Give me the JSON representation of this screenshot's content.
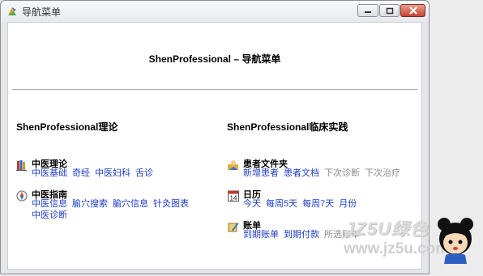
{
  "window": {
    "title": "导航菜单",
    "controls": [
      "minimize",
      "maximize",
      "close"
    ]
  },
  "page": {
    "title": "ShenProfessional – 导航菜单"
  },
  "sections": [
    {
      "heading": "ShenProfessional理论",
      "groups": [
        {
          "icon": "books-icon",
          "title": "中医理论",
          "links": [
            {
              "label": "中医基础",
              "enabled": true
            },
            {
              "label": "奇经",
              "enabled": true
            },
            {
              "label": "中医妇科",
              "enabled": true
            },
            {
              "label": "舌诊",
              "enabled": true
            }
          ]
        },
        {
          "icon": "compass-icon",
          "title": "中医指南",
          "links": [
            {
              "label": "中医信息",
              "enabled": true
            },
            {
              "label": "腧穴搜索",
              "enabled": true
            },
            {
              "label": "腧穴信息",
              "enabled": true
            },
            {
              "label": "针灸图表",
              "enabled": true
            },
            {
              "label": "中医诊断",
              "enabled": true
            }
          ]
        }
      ]
    },
    {
      "heading": "ShenProfessional临床实践",
      "groups": [
        {
          "icon": "patient-folder-icon",
          "title": "患者文件夹",
          "links": [
            {
              "label": "新增患者",
              "enabled": true
            },
            {
              "label": "患者文档",
              "enabled": true
            },
            {
              "label": "下次诊断",
              "enabled": false
            },
            {
              "label": "下次治疗",
              "enabled": false
            }
          ]
        },
        {
          "icon": "calendar-icon",
          "calendar_day": "14",
          "title": "日历",
          "links": [
            {
              "label": "今天",
              "enabled": true
            },
            {
              "label": "每周5天",
              "enabled": true
            },
            {
              "label": "每周7天",
              "enabled": true
            },
            {
              "label": "月份",
              "enabled": true
            }
          ]
        },
        {
          "icon": "bill-pen-icon",
          "title": "账单",
          "links": [
            {
              "label": "到期账单",
              "enabled": true
            },
            {
              "label": "到期付款",
              "enabled": true
            },
            {
              "label": "所选账单",
              "enabled": false
            }
          ]
        }
      ]
    }
  ],
  "watermark": {
    "text": "JZ5U绿色",
    "url": "www.jz5u.com"
  },
  "colors": {
    "link": "#1e3ec6",
    "link_disabled": "#8a8a8a",
    "close_button": "#c7412f"
  }
}
